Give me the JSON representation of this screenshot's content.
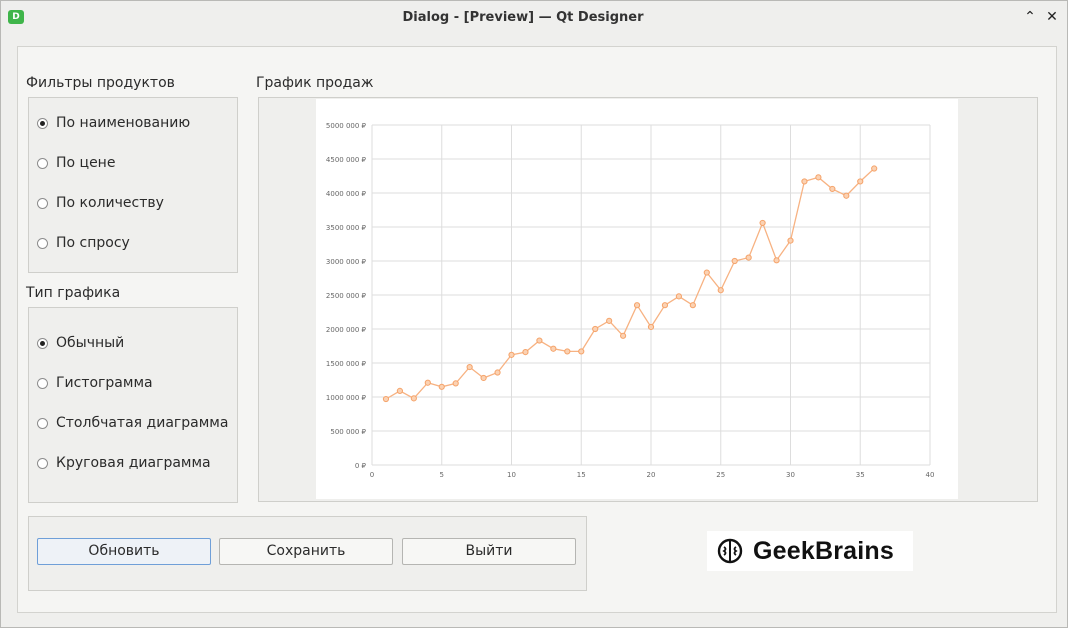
{
  "window": {
    "title": "Dialog - [Preview] — Qt Designer",
    "app_icon_letter": "D",
    "minimize_glyph": "⌃",
    "close_glyph": "✕"
  },
  "filters": {
    "title": "Фильтры продуктов",
    "options": [
      {
        "label": "По наименованию",
        "checked": true
      },
      {
        "label": "По цене",
        "checked": false
      },
      {
        "label": "По количеству",
        "checked": false
      },
      {
        "label": "По спросу",
        "checked": false
      }
    ]
  },
  "chart_type": {
    "title": "Тип графика",
    "options": [
      {
        "label": "Обычный",
        "checked": true
      },
      {
        "label": "Гистограмма",
        "checked": false
      },
      {
        "label": "Столбчатая диаграмма",
        "checked": false
      },
      {
        "label": "Круговая диаграмма",
        "checked": false
      }
    ]
  },
  "chart_panel": {
    "title": "График продаж"
  },
  "buttons": {
    "refresh": "Обновить",
    "save": "Сохранить",
    "exit": "Выйти"
  },
  "logo": {
    "text": "GeekBrains"
  },
  "colors": {
    "line": "#f7b282",
    "marker": "#f5a36a",
    "grid": "#dddddd",
    "accent": "#6f9fd8"
  },
  "chart_data": {
    "type": "line",
    "x_ticks": [
      0,
      5,
      10,
      15,
      20,
      25,
      30,
      35,
      40
    ],
    "y_ticks": [
      0,
      500000,
      1000000,
      1500000,
      2000000,
      2500000,
      3000000,
      3500000,
      4000000,
      4500000,
      5000000
    ],
    "y_tick_labels": [
      "0 ₽",
      "500 000 ₽",
      "1000 000 ₽",
      "1500 000 ₽",
      "2000 000 ₽",
      "2500 000 ₽",
      "3000 000 ₽",
      "3500 000 ₽",
      "4000 000 ₽",
      "4500 000 ₽",
      "5000 000 ₽"
    ],
    "xlim": [
      0,
      40
    ],
    "ylim": [
      0,
      5000000
    ],
    "grid": true,
    "x": [
      1,
      2,
      3,
      4,
      5,
      6,
      7,
      8,
      9,
      10,
      11,
      12,
      13,
      14,
      15,
      16,
      17,
      18,
      19,
      20,
      21,
      22,
      23,
      24,
      25,
      26,
      27,
      28,
      29,
      30,
      31,
      32,
      33,
      34,
      35,
      36
    ],
    "values": [
      970000,
      1090000,
      980000,
      1210000,
      1150000,
      1200000,
      1440000,
      1280000,
      1360000,
      1620000,
      1660000,
      1830000,
      1710000,
      1670000,
      1670000,
      2000000,
      2120000,
      1900000,
      2350000,
      2030000,
      2350000,
      2480000,
      2350000,
      2830000,
      2570000,
      3000000,
      3050000,
      3560000,
      3010000,
      3300000,
      4170000,
      4230000,
      4060000,
      3960000,
      4170000,
      4360000
    ]
  }
}
